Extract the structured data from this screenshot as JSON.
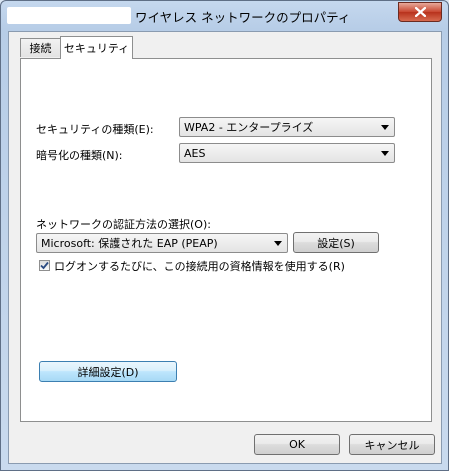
{
  "window": {
    "title": "ワイヤレス ネットワークのプロパティ"
  },
  "tabs": [
    {
      "label": "接続",
      "active": false
    },
    {
      "label": "セキュリティ",
      "active": true
    }
  ],
  "security": {
    "security_type_label": "セキュリティの種類(E):",
    "security_type_value": "WPA2 - エンタープライズ",
    "encryption_type_label": "暗号化の種類(N):",
    "encryption_type_value": "AES",
    "auth_method_label": "ネットワークの認証方法の選択(O):",
    "auth_method_value": "Microsoft: 保護された EAP (PEAP)",
    "settings_button": "設定(S)",
    "remember_credentials_label": "ログオンするたびに、この接続用の資格情報を使用する(R)",
    "remember_credentials_checked": true,
    "advanced_button": "詳細設定(D)"
  },
  "footer": {
    "ok": "OK",
    "cancel": "キャンセル"
  },
  "icons": {
    "close": "close-icon",
    "dropdown": "chevron-down-icon",
    "check": "checkmark-icon"
  }
}
